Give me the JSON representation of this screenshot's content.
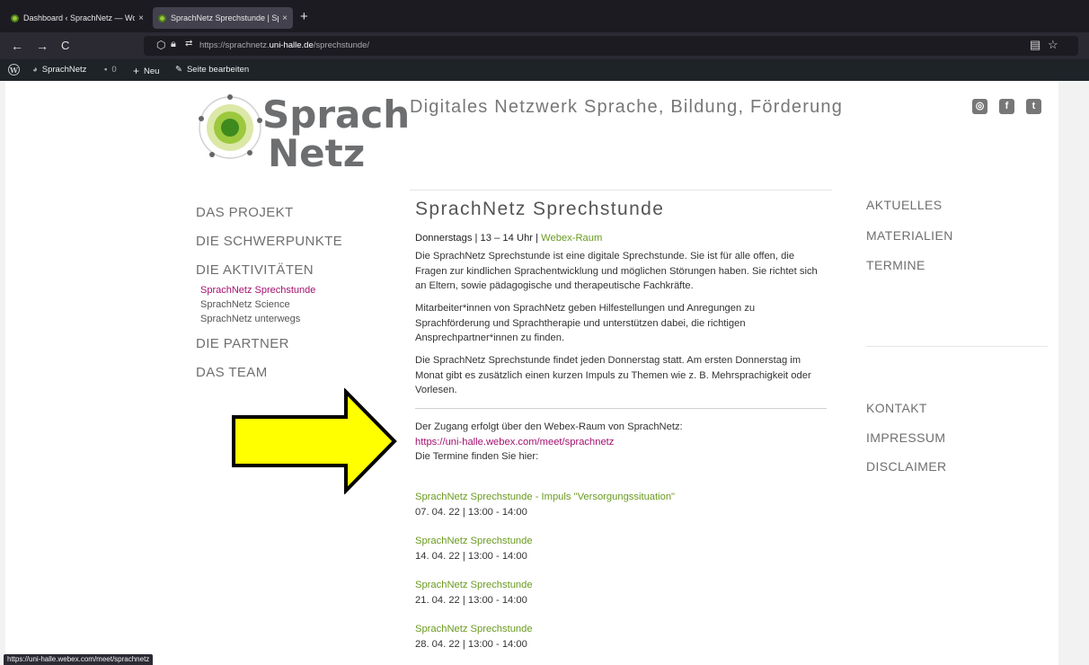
{
  "browser": {
    "tabs": [
      {
        "title": "Dashboard ‹ SprachNetz — Wor",
        "close": "×"
      },
      {
        "title": "SprachNetz Sprechstunde | Spra",
        "close": "×"
      }
    ],
    "new_tab": "+",
    "nav": {
      "back": "←",
      "forward": "→",
      "reload": "C"
    },
    "url": {
      "prefix": "https://sprachnetz.",
      "domain": "uni-halle.de",
      "path": "/sprechstunde/"
    },
    "status_url": "https://uni-halle.webex.com/meet/sprachnetz"
  },
  "wp_admin_bar": {
    "site_name": "SprachNetz",
    "comments_count": "0",
    "new_label": "Neu",
    "edit_label": "Seite bearbeiten"
  },
  "site": {
    "logo_line1": "Sprach",
    "logo_line2": "Netz",
    "tagline": "Digitales Netzwerk Sprache, Bildung, Förderung",
    "social": {
      "instagram": "◎",
      "facebook": "f",
      "twitter": "t"
    }
  },
  "left_nav": {
    "projekt": "DAS PROJEKT",
    "schwerpunkte": "DIE SCHWERPUNKTE",
    "aktivitaeten": "DIE AKTIVITÄTEN",
    "sub": [
      "SprachNetz Sprechstunde",
      "SprachNetz Science",
      "SprachNetz unterwegs"
    ],
    "partner": "DIE PARTNER",
    "team": "DAS TEAM"
  },
  "main": {
    "title": "SprachNetz Sprechstunde",
    "subheading_pre": "Donnerstags | 13 – 14 Uhr | ",
    "subheading_link": "Webex-Raum",
    "p1": "Die SprachNetz Sprechstunde ist eine digitale Sprechstunde. Sie ist für alle offen, die Fragen zur kindlichen Sprachentwicklung und möglichen Störungen haben. Sie richtet sich an Eltern, sowie pädagogische und therapeutische Fachkräfte.",
    "p2": "Mitarbeiter*innen von SprachNetz geben Hilfestellungen und Anregungen zu Sprachförderung und Sprachtherapie und unterstützen dabei, die richtigen Ansprechpartner*innen zu finden.",
    "p3": "Die SprachNetz Sprechstunde findet jeden Donnerstag statt. Am ersten Donnerstag im Monat gibt es zusätzlich einen kurzen Impuls zu Themen wie z. B. Mehrsprachigkeit oder Vorlesen.",
    "access_text": "Der Zugang erfolgt über den Webex-Raum von SprachNetz:",
    "access_link": "https://uni-halle.webex.com/meet/sprachnetz",
    "termine_text": "Die Termine finden Sie hier:",
    "events": [
      {
        "title": "SprachNetz Sprechstunde - Impuls \"Versorgungssituation\"",
        "date": "07. 04. 22 | 13:00 - 14:00"
      },
      {
        "title": "SprachNetz Sprechstunde",
        "date": "14. 04. 22 | 13:00 - 14:00"
      },
      {
        "title": "SprachNetz Sprechstunde",
        "date": "21. 04. 22 | 13:00 - 14:00"
      },
      {
        "title": "SprachNetz Sprechstunde",
        "date": "28. 04. 22 | 13:00 - 14:00"
      }
    ]
  },
  "right_nav": {
    "aktuelles": "AKTUELLES",
    "materialien": "MATERIALIEN",
    "termine": "TERMINE",
    "kontakt": "KONTAKT",
    "impressum": "IMPRESSUM",
    "disclaimer": "DISCLAIMER"
  },
  "colors": {
    "accent_green": "#6a9a1f",
    "accent_magenta": "#a4106e",
    "arrow_fill": "#ffff00"
  }
}
